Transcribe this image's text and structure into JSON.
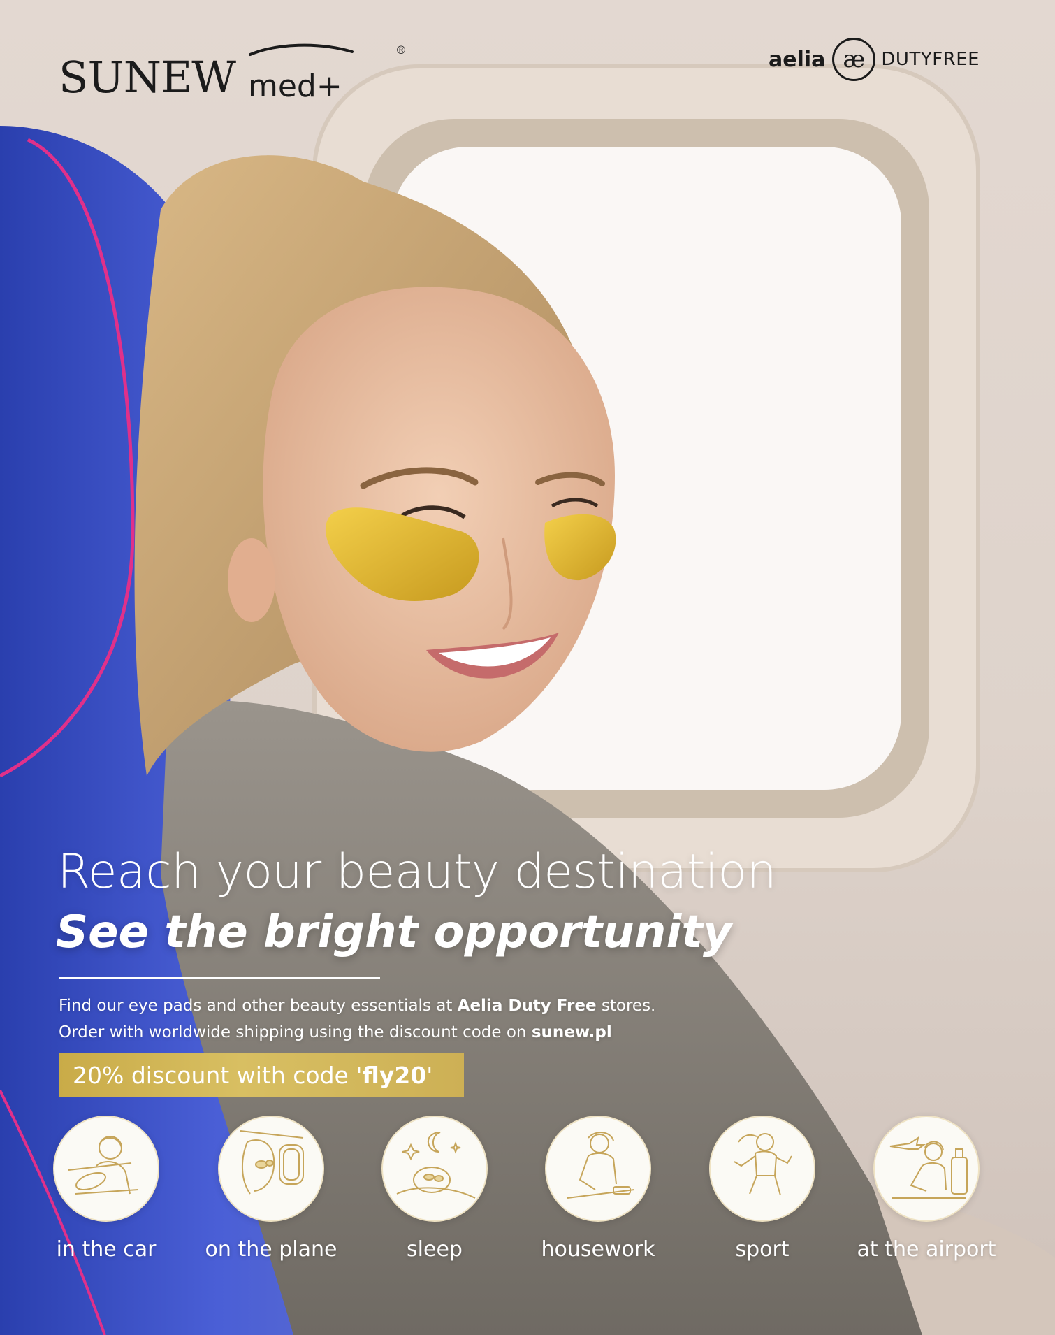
{
  "brand": {
    "name": "SUNEW",
    "sub": "med+",
    "registered": "®"
  },
  "retailer": {
    "word": "aelia",
    "mark": "æ",
    "suffix": "DUTYFREE"
  },
  "headline": "Reach your beauty destination",
  "subheadline": "See the bright opportunity",
  "body": {
    "line1_pre": "Find our eye pads and other beauty essentials at ",
    "line1_bold": "Aelia Duty Free",
    "line1_post": " stores.",
    "line2_pre": "Order with worldwide shipping using the discount code on ",
    "line2_bold": "sunew.pl"
  },
  "badge": {
    "pre": "20% discount with code '",
    "code": "fly20",
    "post": "'"
  },
  "icons": [
    {
      "label": "in the car",
      "icon": "driving-woman-icon"
    },
    {
      "label": "on the plane",
      "icon": "plane-window-woman-icon"
    },
    {
      "label": "sleep",
      "icon": "sleeping-woman-icon"
    },
    {
      "label": "housework",
      "icon": "cleaning-woman-icon"
    },
    {
      "label": "sport",
      "icon": "running-woman-icon"
    },
    {
      "label": "at the airport",
      "icon": "airport-woman-icon"
    }
  ],
  "colors": {
    "background": "#e0d6ce",
    "seat_blue": "#3d52c9",
    "seat_piping": "#e0308a",
    "gold": "#d2b457",
    "icon_line": "#c6a55a"
  }
}
